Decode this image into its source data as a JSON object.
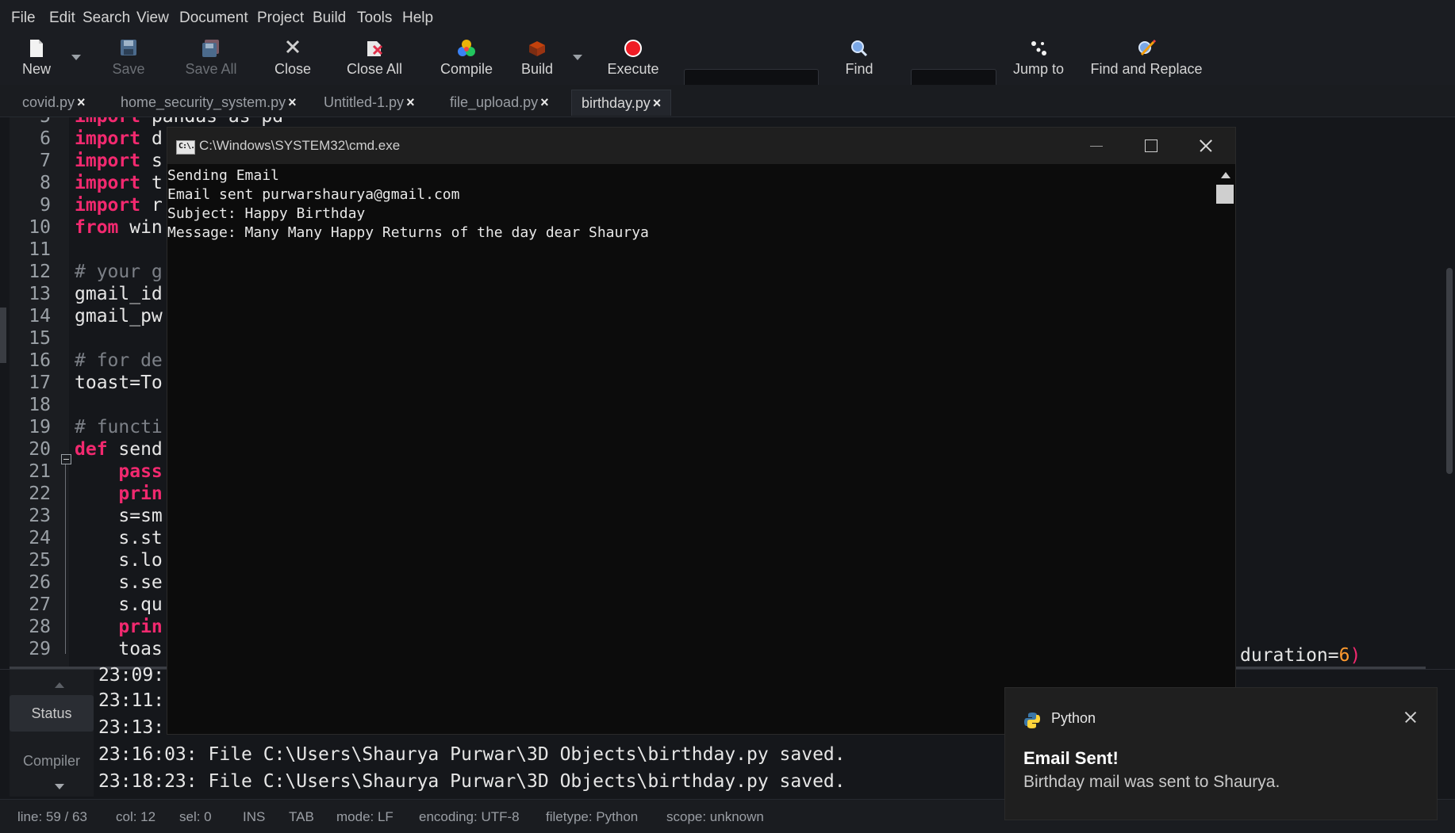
{
  "menu": [
    "File",
    "Edit",
    "Search",
    "View",
    "Document",
    "Project",
    "Build",
    "Tools",
    "Help"
  ],
  "toolbar": {
    "new": "New",
    "save": "Save",
    "save_all": "Save All",
    "close": "Close",
    "close_all": "Close All",
    "compile": "Compile",
    "build": "Build",
    "execute": "Execute",
    "find": "Find",
    "jump_to": "Jump to",
    "find_replace": "Find and Replace"
  },
  "tabs": [
    {
      "label": "covid.py"
    },
    {
      "label": "home_security_system.py"
    },
    {
      "label": "Untitled-1.py"
    },
    {
      "label": "file_upload.py"
    },
    {
      "label": "birthday.py"
    }
  ],
  "tab_close": "×",
  "editor": {
    "lines": [
      {
        "n": "5",
        "kw": "import",
        "rest": " pandas as pd"
      },
      {
        "n": "6",
        "kw": "import",
        "rest": " d"
      },
      {
        "n": "7",
        "kw": "import",
        "rest": " s"
      },
      {
        "n": "8",
        "kw": "import",
        "rest": " t"
      },
      {
        "n": "9",
        "kw": "import",
        "rest": " r"
      },
      {
        "n": "10",
        "kw": "from",
        "rest": " win"
      },
      {
        "n": "11",
        "kw": "",
        "rest": ""
      },
      {
        "n": "12",
        "cm": "# your g"
      },
      {
        "n": "13",
        "kw": "",
        "rest": "gmail_id"
      },
      {
        "n": "14",
        "kw": "",
        "rest": "gmail_pw"
      },
      {
        "n": "15",
        "kw": "",
        "rest": ""
      },
      {
        "n": "16",
        "cm": "# for de"
      },
      {
        "n": "17",
        "kw": "",
        "rest": "toast=To"
      },
      {
        "n": "18",
        "kw": "",
        "rest": ""
      },
      {
        "n": "19",
        "cm": "# functi"
      },
      {
        "n": "20",
        "kw": "def",
        "rest": " send"
      },
      {
        "n": "21",
        "kw": "    pass",
        "rest": ""
      },
      {
        "n": "22",
        "kw": "    prin",
        "rest": ""
      },
      {
        "n": "23",
        "kw": "",
        "rest": "    s=sm"
      },
      {
        "n": "24",
        "kw": "",
        "rest": "    s.st"
      },
      {
        "n": "25",
        "kw": "",
        "rest": "    s.lo"
      },
      {
        "n": "26",
        "kw": "",
        "rest": "    s.se"
      },
      {
        "n": "27",
        "kw": "",
        "rest": "    s.qu"
      },
      {
        "n": "28",
        "kw": "    prin",
        "rest": ""
      },
      {
        "n": "29",
        "kw": "",
        "rest": "    toas"
      }
    ],
    "duration_text": "duration=",
    "duration_value": "6",
    "duration_close": ")"
  },
  "messages": {
    "side_tabs": [
      "Status",
      "Compiler"
    ],
    "lines": [
      "23:09:",
      "23:11:",
      "23:13:",
      "23:16:03: File C:\\Users\\Shaurya Purwar\\3D Objects\\birthday.py saved.",
      "23:18:23: File C:\\Users\\Shaurya Purwar\\3D Objects\\birthday.py saved."
    ]
  },
  "status": {
    "line": "line: 59 / 63",
    "col": "col: 12",
    "sel": "sel: 0",
    "ins": "INS",
    "tab": "TAB",
    "mode": "mode: LF",
    "encoding": "encoding: UTF-8",
    "filetype": "filetype: Python",
    "scope": "scope: unknown"
  },
  "cmd": {
    "title": "C:\\Windows\\SYSTEM32\\cmd.exe",
    "icon_text": "C:\\.",
    "output": [
      "Sending Email",
      "Email sent purwarshaurya@gmail.com",
      "Subject: Happy Birthday",
      "Message: Many Many Happy Returns of the day dear Shaurya"
    ]
  },
  "toast": {
    "app": "Python",
    "title": "Email Sent!",
    "message": "Birthday mail was sent to Shaurya."
  },
  "colors": {
    "keyword": "#f2296f",
    "number": "#ff9a2e",
    "background": "#15171b"
  }
}
